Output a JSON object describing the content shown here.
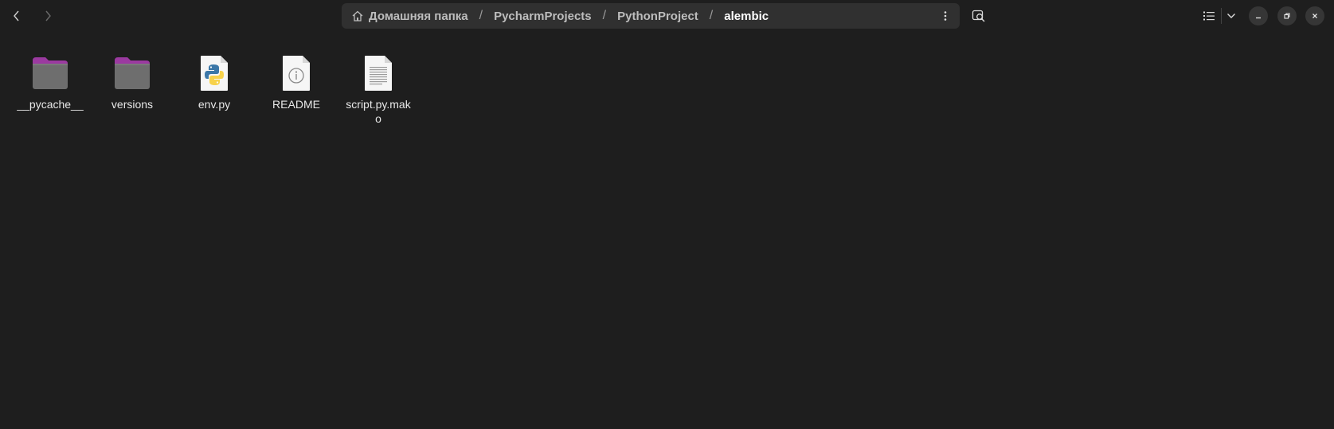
{
  "nav": {
    "back_icon": "chevron-left-icon",
    "forward_icon": "chevron-right-icon"
  },
  "pathbar": {
    "home_icon": "home-icon",
    "crumbs": [
      "Домашняя папка",
      "PycharmProjects",
      "PythonProject",
      "alembic"
    ],
    "separator": "/",
    "menu_icon": "vertical-dots-icon"
  },
  "toolbar": {
    "search_icon": "search-icon",
    "view_icon": "list-view-icon",
    "view_menu_icon": "chevron-down-icon"
  },
  "window": {
    "minimize_icon": "minimize-icon",
    "maximize_icon": "restore-icon",
    "close_icon": "close-icon"
  },
  "files": [
    {
      "name": "__pycache__",
      "type": "folder"
    },
    {
      "name": "versions",
      "type": "folder"
    },
    {
      "name": "env.py",
      "type": "python"
    },
    {
      "name": "README",
      "type": "info"
    },
    {
      "name": "script.py.mako",
      "type": "text"
    }
  ],
  "colors": {
    "background": "#1e1e1e",
    "pathbar": "#303030",
    "folder_tab": "#9b3aa0",
    "folder_body": "#6e6e6e"
  }
}
